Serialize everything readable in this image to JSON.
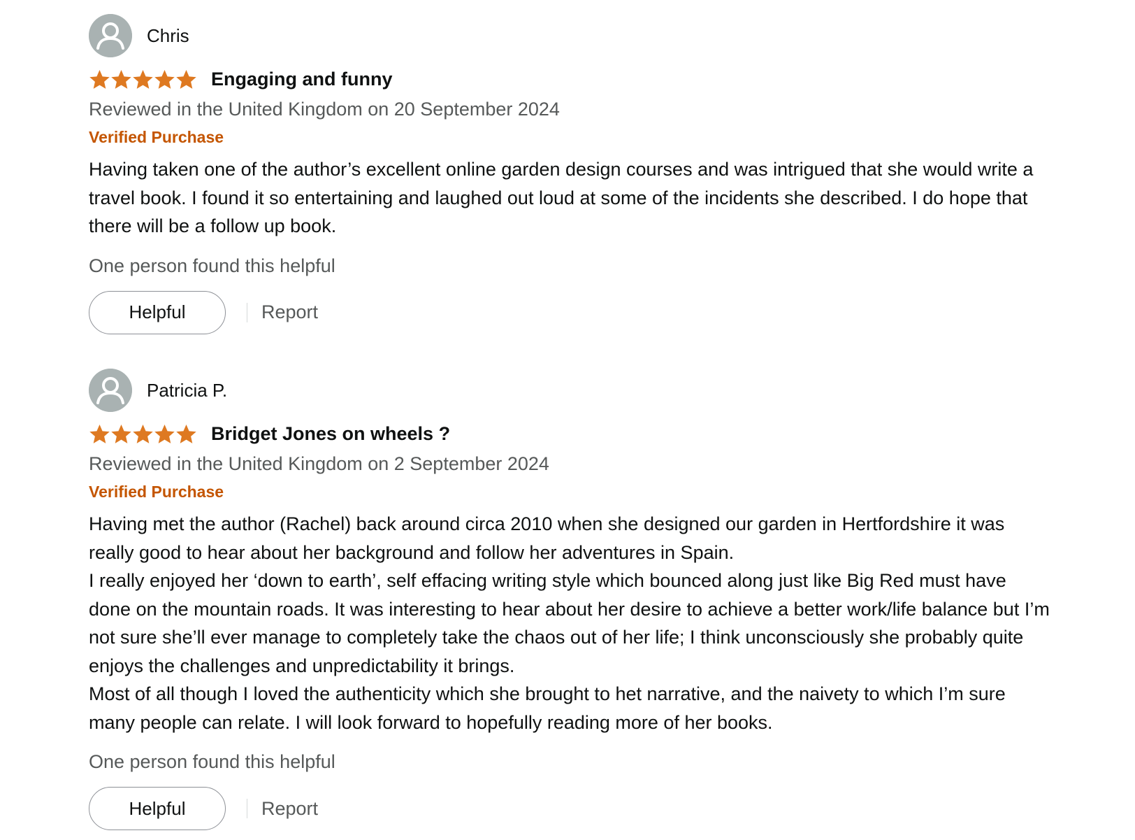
{
  "reviews": [
    {
      "profile_name": "Chris",
      "rating": 5,
      "max_rating": 5,
      "title": "Engaging and funny",
      "date": "Reviewed in the United Kingdom on 20 September 2024",
      "verified": "Verified Purchase",
      "body": [
        "Having taken one of the author’s excellent online garden design courses and was intrigued that she would write a travel book. I found it so entertaining and laughed out loud at some of the incidents she described. I do hope that there will be a follow up book."
      ],
      "helpful_count": "One person found this helpful",
      "helpful_label": "Helpful",
      "report_label": "Report"
    },
    {
      "profile_name": "Patricia P.",
      "rating": 5,
      "max_rating": 5,
      "title": "Bridget Jones on wheels ?",
      "date": "Reviewed in the United Kingdom on 2 September 2024",
      "verified": "Verified Purchase",
      "body": [
        "Having met the author (Rachel) back around circa 2010 when she designed our garden in Hertfordshire it was really good to hear about her background and follow her adventures in Spain.",
        "I really enjoyed her ‘down to earth’, self effacing writing style which bounced along just like Big Red must have done on the mountain roads. It was interesting to hear about her desire to achieve a better work/life balance but I’m not sure she’ll ever manage to completely take the chaos out of her life; I think unconsciously she probably quite enjoys the challenges and unpredictability it brings.",
        "Most of all though I loved the authenticity which she brought to het narrative, and the naivety to which I’m sure many people can relate. I will look forward to hopefully reading more of her books."
      ],
      "helpful_count": "One person found this helpful",
      "helpful_label": "Helpful",
      "report_label": "Report"
    }
  ],
  "colors": {
    "star": "#de7921",
    "verified": "#c45500",
    "secondary_text": "#565959",
    "avatar_bg": "#a9b2b2"
  },
  "icons": {
    "avatar": "user-avatar-icon",
    "star": "star-icon"
  }
}
